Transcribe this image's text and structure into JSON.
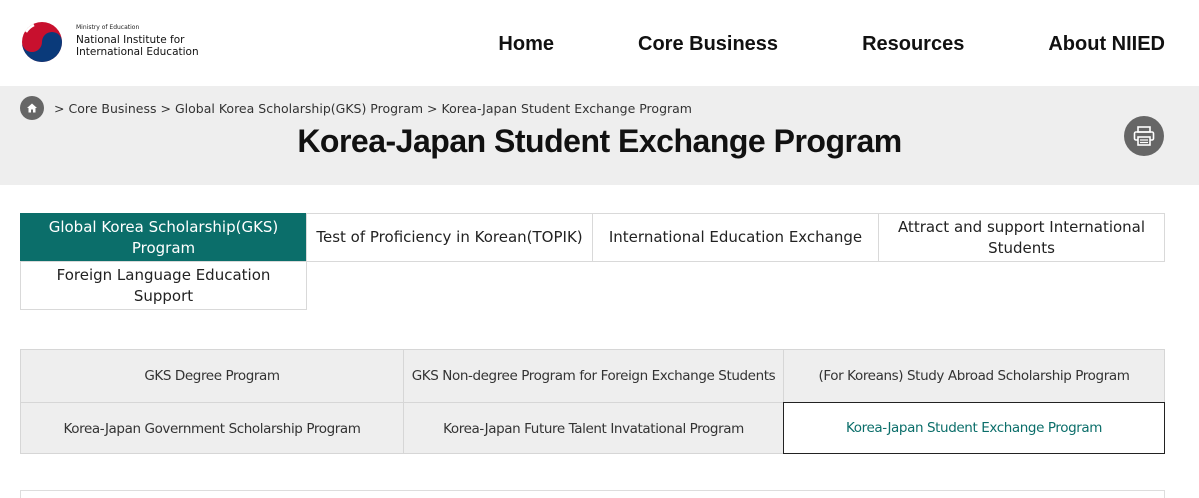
{
  "logo": {
    "ministry": "Ministry of Education",
    "line1": "National Institute for",
    "line2": "International Education"
  },
  "nav": [
    "Home",
    "Core Business",
    "Resources",
    "About NIIED"
  ],
  "breadcrumb": {
    "home_icon": "home-icon",
    "separator": ">",
    "items": [
      "Core Business",
      "Global Korea Scholarship(GKS) Program",
      "Korea-Japan Student Exchange Program"
    ]
  },
  "page_title": "Korea-Japan Student Exchange Program",
  "print_icon": "printer-icon",
  "tabs": [
    {
      "label": "Global Korea Scholarship(GKS) Program",
      "active": true
    },
    {
      "label": "Test of Proficiency in Korean(TOPIK)",
      "active": false
    },
    {
      "label": "International Education Exchange",
      "active": false
    },
    {
      "label": "Attract and support International Students",
      "active": false
    },
    {
      "label": "Foreign Language Education Support",
      "active": false
    }
  ],
  "subtabs": [
    {
      "label": "GKS Degree Program",
      "active": false
    },
    {
      "label": "GKS Non-degree Program for Foreign Exchange Students",
      "active": false
    },
    {
      "label": "(For Koreans) Study Abroad Scholarship Program",
      "active": false
    },
    {
      "label": "Korea-Japan Government Scholarship Program",
      "active": false
    },
    {
      "label": "Korea-Japan Future Talent Invatational Program",
      "active": false
    },
    {
      "label": "Korea-Japan Student Exchange Program",
      "active": true
    }
  ],
  "colors": {
    "accent": "#0b6e6a",
    "band": "#eeeeee",
    "icon_circle": "#666666"
  }
}
